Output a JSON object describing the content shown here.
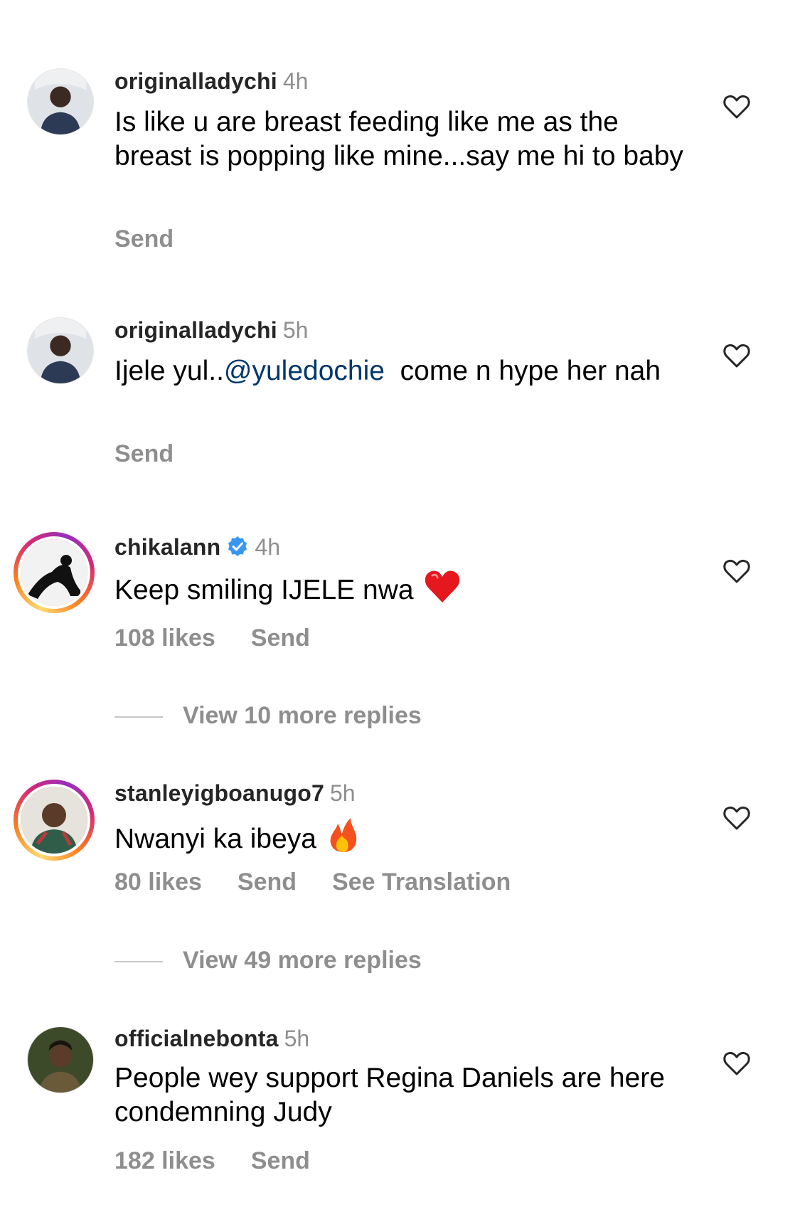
{
  "comments": [
    {
      "username": "originalladychi",
      "time": "4h",
      "text": "Is like u are breast feeding like me as the breast is popping like mine...say me hi to baby",
      "send_label": "Send"
    },
    {
      "username": "originalladychi",
      "time": "5h",
      "text_before": "Ijele yul..",
      "mention": "@yuledochie",
      "text_after": "  come n hype her nah",
      "send_label": "Send"
    },
    {
      "username": "chikalann",
      "verified": true,
      "time": "4h",
      "text": "Keep smiling IJELE nwa",
      "emoji": "red-heart",
      "likes": "108 likes",
      "send_label": "Send",
      "replies": "View 10 more replies"
    },
    {
      "username": "stanleyigboanugo7",
      "time": "5h",
      "text": "Nwanyi ka ibeya",
      "emoji": "fire",
      "likes": "80 likes",
      "send_label": "Send",
      "translate_label": "See Translation",
      "replies": "View 49 more replies"
    },
    {
      "username": "officialnebonta",
      "time": "5h",
      "text": "People wey support Regina Daniels are here condemning Judy",
      "likes": "182 likes",
      "send_label": "Send"
    }
  ],
  "icons": {
    "like": "heart-outline-icon",
    "verified": "verified-badge-icon"
  },
  "colors": {
    "username": "#262626",
    "secondary_text": "#8e8e8e",
    "mention": "#00376b",
    "verified_blue": "#3897f0"
  }
}
